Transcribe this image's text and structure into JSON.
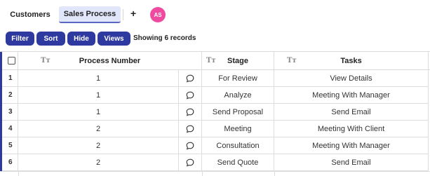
{
  "tabs": [
    {
      "label": "Customers",
      "active": false
    },
    {
      "label": "Sales Process",
      "active": true
    }
  ],
  "add_tab_label": "+",
  "user": {
    "initials": "AS",
    "color": "#ee4aa0"
  },
  "toolbar": {
    "filter_label": "Filter",
    "sort_label": "Sort",
    "hide_label": "Hide",
    "views_label": "Views",
    "records_text": "Showing 6 records"
  },
  "colors": {
    "accent": "#2e3a9f",
    "active_tab_bg": "#e1e6fa"
  },
  "table": {
    "columns": [
      {
        "label": "Process Number",
        "icon": "text-type-icon"
      },
      {
        "label": "Stage",
        "icon": "text-type-icon"
      },
      {
        "label": "Tasks",
        "icon": "text-type-icon"
      }
    ],
    "rows": [
      {
        "index": "1",
        "process_number": "1",
        "stage": "For Review",
        "tasks": "View Details"
      },
      {
        "index": "2",
        "process_number": "1",
        "stage": "Analyze",
        "tasks": "Meeting With Manager"
      },
      {
        "index": "3",
        "process_number": "1",
        "stage": "Send Proposal",
        "tasks": "Send Email"
      },
      {
        "index": "4",
        "process_number": "2",
        "stage": "Meeting",
        "tasks": "Meeting With Client"
      },
      {
        "index": "5",
        "process_number": "2",
        "stage": "Consultation",
        "tasks": "Meeting With Manager"
      },
      {
        "index": "6",
        "process_number": "2",
        "stage": "Send Quote",
        "tasks": "Send Email"
      }
    ]
  }
}
